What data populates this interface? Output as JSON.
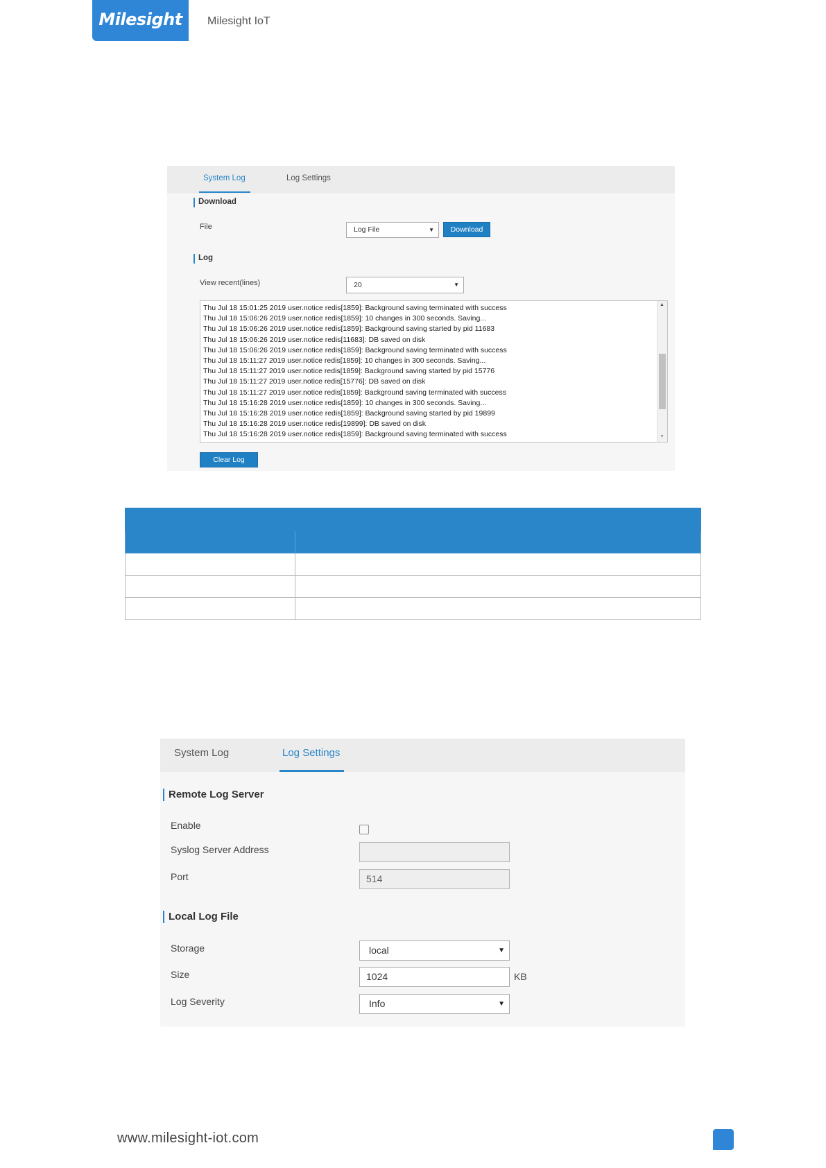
{
  "header": {
    "logo_text": "Milesight",
    "company": "Milesight IoT"
  },
  "panel1": {
    "tabs": [
      {
        "label": "System Log",
        "active": true
      },
      {
        "label": "Log Settings",
        "active": false
      }
    ],
    "download": {
      "section": "Download",
      "file_label": "File",
      "file_value": "Log File",
      "button": "Download"
    },
    "log": {
      "section": "Log",
      "view_label": "View recent(lines)",
      "view_value": "20"
    },
    "log_lines": [
      "Thu Jul 18 15:01:25 2019 user.notice redis[1859]: Background saving terminated with success",
      "Thu Jul 18 15:06:26 2019 user.notice redis[1859]: 10 changes in 300 seconds. Saving...",
      "Thu Jul 18 15:06:26 2019 user.notice redis[1859]: Background saving started by pid 11683",
      "Thu Jul 18 15:06:26 2019 user.notice redis[11683]: DB saved on disk",
      "Thu Jul 18 15:06:26 2019 user.notice redis[1859]: Background saving terminated with success",
      "Thu Jul 18 15:11:27 2019 user.notice redis[1859]: 10 changes in 300 seconds. Saving...",
      "Thu Jul 18 15:11:27 2019 user.notice redis[1859]: Background saving started by pid 15776",
      "Thu Jul 18 15:11:27 2019 user.notice redis[15776]: DB saved on disk",
      "Thu Jul 18 15:11:27 2019 user.notice redis[1859]: Background saving terminated with success",
      "Thu Jul 18 15:16:28 2019 user.notice redis[1859]: 10 changes in 300 seconds. Saving...",
      "Thu Jul 18 15:16:28 2019 user.notice redis[1859]: Background saving started by pid 19899",
      "Thu Jul 18 15:16:28 2019 user.notice redis[19899]: DB saved on disk",
      "Thu Jul 18 15:16:28 2019 user.notice redis[1859]: Background saving terminated with success"
    ],
    "clear_button": "Clear Log"
  },
  "panel2": {
    "tabs": [
      {
        "label": "System Log",
        "active": false
      },
      {
        "label": "Log Settings",
        "active": true
      }
    ],
    "remote": {
      "section": "Remote Log Server",
      "enable_label": "Enable",
      "enable_checked": false,
      "address_label": "Syslog Server Address",
      "address_value": "",
      "port_label": "Port",
      "port_value": "514"
    },
    "local": {
      "section": "Local Log File",
      "storage_label": "Storage",
      "storage_value": "local",
      "size_label": "Size",
      "size_value": "1024",
      "size_unit": "KB",
      "severity_label": "Log Severity",
      "severity_value": "Info"
    }
  },
  "footer": {
    "url": "www.milesight-iot.com"
  },
  "colors": {
    "brand": "#2f86d6",
    "accent": "#2a86c9"
  }
}
